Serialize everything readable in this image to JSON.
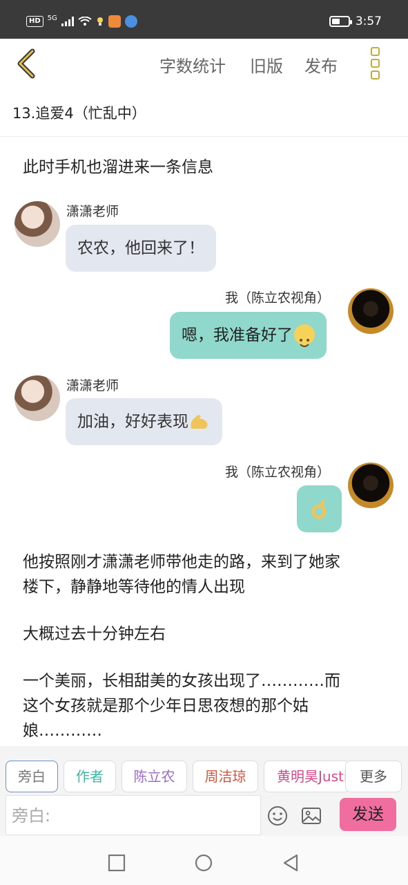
{
  "status": {
    "hd": "HD",
    "signal_label": "5G",
    "time": "3:57"
  },
  "toolbar": {
    "word_count": "字数统计",
    "old_version": "旧版",
    "publish": "发布"
  },
  "chapter_title": "13.追爱4（忙乱中）",
  "narration_top": "此时手机也溜进来一条信息",
  "messages": [
    {
      "sender": "潇潇老师",
      "text": "农农，他回来了！"
    },
    {
      "sender": "我（陈立农视角）",
      "text": "嗯，我准备好了"
    },
    {
      "sender": "潇潇老师",
      "text": "加油，好好表现"
    },
    {
      "sender": "我（陈立农视角）",
      "text": ""
    }
  ],
  "narration_bottom": {
    "line1": "他按照刚才潇潇老师带他走的路，来到了她家",
    "line2": "楼下，静静地等待他的情人出现",
    "line3": "大概过去十分钟左右",
    "line4": "一个美丽，长相甜美的女孩出现了…………而",
    "line5": "这个女孩就是那个少年日思夜想的那个姑",
    "line6": "娘…………"
  },
  "characters": [
    "旁白",
    "作者",
    "陈立农",
    "周洁琼",
    "黄明昊Justin"
  ],
  "more_label": "更多",
  "input_placeholder": "旁白:",
  "send_label": "发送",
  "colors": {
    "accent": "#c9a83a",
    "bubble_right": "#8fd8cb",
    "bubble_left": "#e3e8f0",
    "send": "#ef6e9f"
  },
  "icons": [
    "back-chevron-icon",
    "more-menu-icon",
    "emoji-icon",
    "image-icon",
    "nav-square-icon",
    "nav-circle-icon",
    "nav-back-icon"
  ]
}
